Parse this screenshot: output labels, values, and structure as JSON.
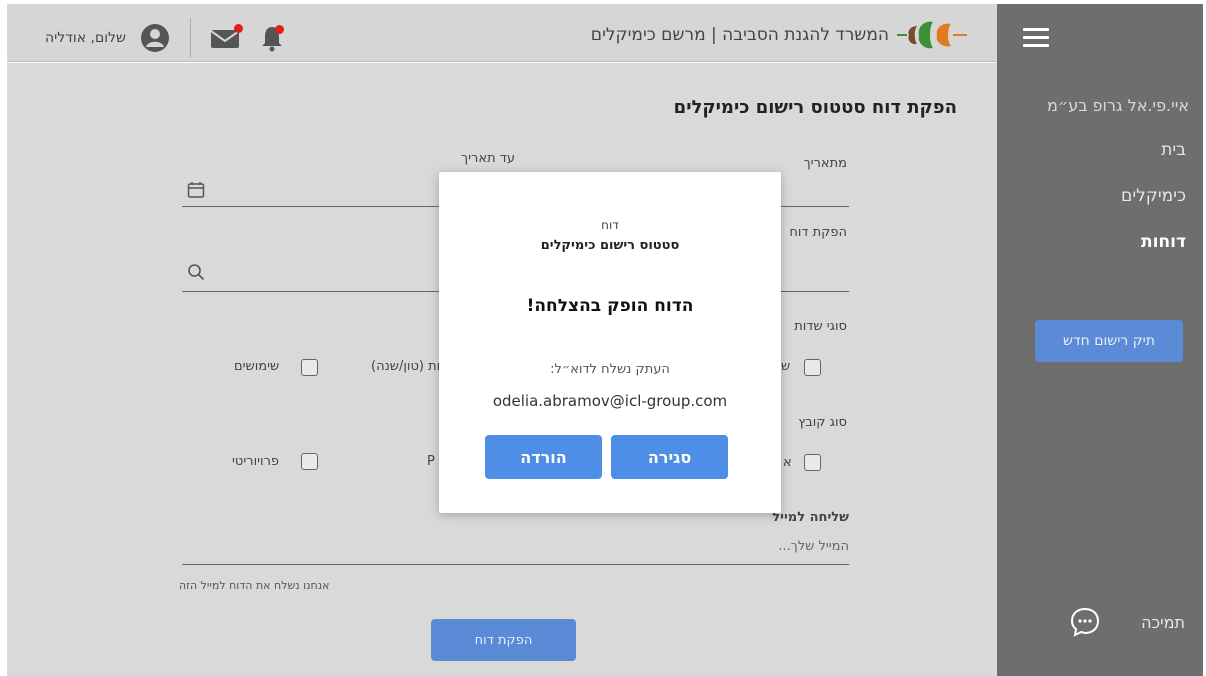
{
  "header": {
    "title": "המשרד להגנת הסביבה | מרשם כימיקלים",
    "greeting": "שלום, אודליה",
    "icons": [
      "bell-icon",
      "mail-icon",
      "user-avatar-icon",
      "ministry-logo"
    ]
  },
  "sidebar": {
    "company": "איי.פי.אל גרופ בע״מ",
    "items": [
      {
        "label": "בית",
        "active": false
      },
      {
        "label": "כימיקלים",
        "active": false
      },
      {
        "label": "דוחות",
        "active": true
      }
    ],
    "new_file_button": "תיק רישום חדש",
    "support_label": "תמיכה"
  },
  "main": {
    "page_title": "הפקת דוח סטטוס רישום כימיקלים",
    "from_date_label": "מתאריך",
    "to_date_label": "עד תאריך",
    "report_search_label": "הפקת דוח",
    "field_types_label": "סוגי שדות",
    "checkbox_uses": "שימושים",
    "checkbox_quantity": "ות (טון/שנה)",
    "checkbox_partial_right": "ש",
    "file_type_label": "סוג קובץ",
    "checkbox_privacy": "פרויוריטי",
    "checkbox_partial_p": "P",
    "checkbox_partial_a": "א",
    "email_label": "שליחה למייל",
    "email_placeholder": "המייל שלך...",
    "email_hint": "אנחנו נשלח את הדוח למייל הזה",
    "generate_button": "הפקת דוח"
  },
  "modal": {
    "kicker": "דוח",
    "subtitle": "סטטוס רישום כימיקלים",
    "success": "הדוח הופק בהצלחה!",
    "sent_to": "העתק נשלח לדוא״ל:",
    "email": "odelia.abramov@icl-group.com",
    "close_button": "סגירה",
    "download_button": "הורדה"
  },
  "colors": {
    "sidebar_bg": "#6e6e6e",
    "accent_blue": "#4f8ee6",
    "muted_blue": "#5b8bd6",
    "overlay_gray": "#d9d9d9",
    "notification_red": "#e01d1d"
  }
}
